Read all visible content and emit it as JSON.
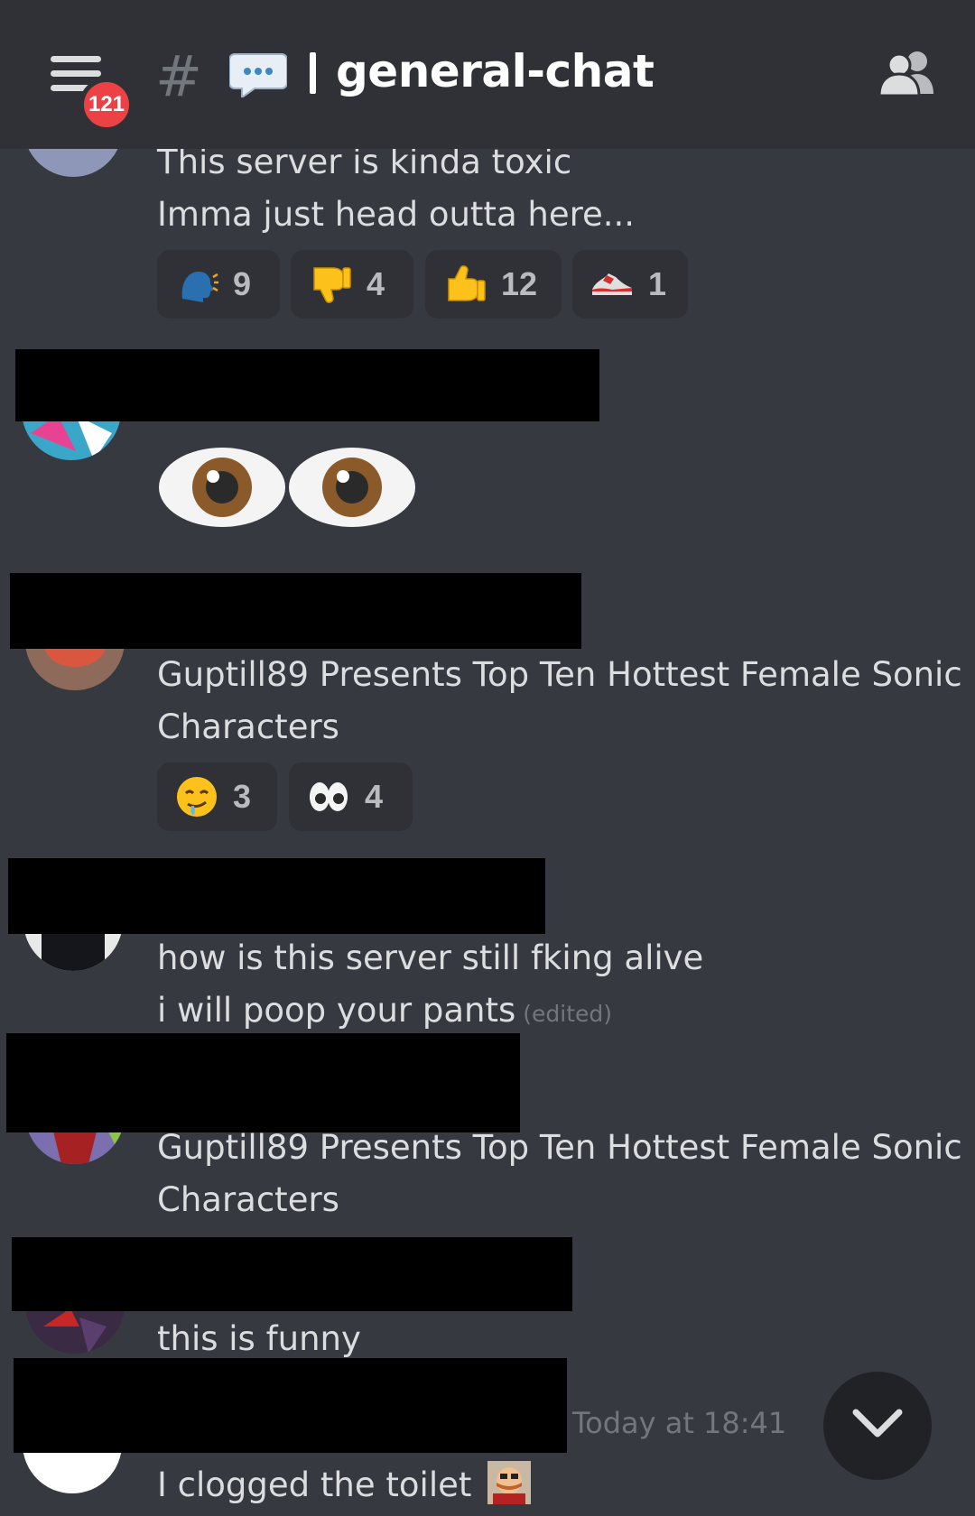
{
  "header": {
    "unread_badge": "121",
    "hash_symbol": "#",
    "channel_name": "general-chat"
  },
  "messages": [
    {
      "lines": [
        "This server is kinda toxic",
        "Imma just head outta here..."
      ],
      "reactions": [
        {
          "emoji": "speaking-head",
          "count": "9"
        },
        {
          "emoji": "thumbs-down",
          "count": "4"
        },
        {
          "emoji": "thumbs-up",
          "count": "12"
        },
        {
          "emoji": "sneaker",
          "count": "1"
        }
      ]
    },
    {
      "emoji_only": "eyes-large"
    },
    {
      "lines": [
        "Guptill89 Presents Top Ten Hottest Female Sonic",
        "Characters"
      ],
      "reactions": [
        {
          "emoji": "drooling-face",
          "count": "3"
        },
        {
          "emoji": "eyes",
          "count": "4"
        }
      ]
    },
    {
      "lines": [
        "how is this server still fking alive",
        "i will poop your pants"
      ],
      "edited": "(edited)"
    },
    {
      "lines": [
        "Guptill89 Presents Top Ten Hottest Female Sonic",
        "Characters"
      ]
    },
    {
      "lines": [
        "this is funny"
      ]
    },
    {
      "timestamp": "Today at 18:41",
      "lines": [
        "I clogged the toilet"
      ],
      "inline_emoji": "eggman-emoji"
    }
  ],
  "icons": {
    "menu": "hamburger-menu-icon",
    "members": "members-icon",
    "scroll_down": "chevron-down-icon"
  },
  "colors": {
    "background": "#36393f",
    "header": "#2f3136",
    "badge": "#ed4245",
    "text": "#dcddde",
    "muted": "#72767d"
  }
}
